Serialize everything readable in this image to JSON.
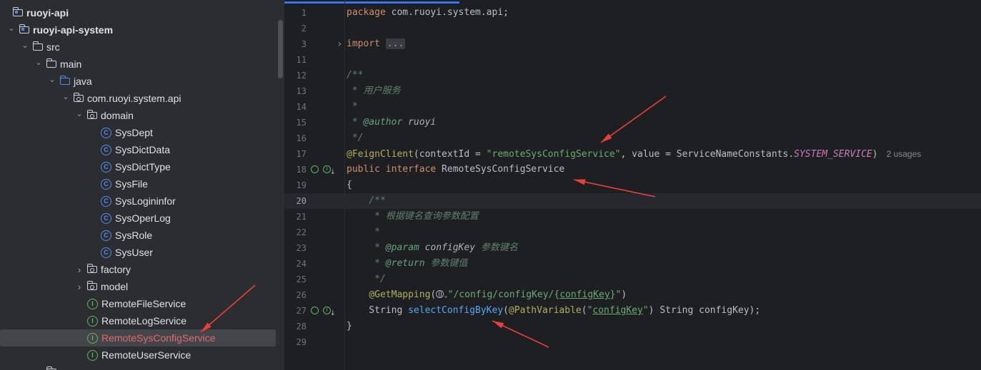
{
  "project_tree": {
    "items": [
      {
        "label": "ruoyi-api",
        "depth": 0,
        "icon": "module-folder-icon",
        "expand": "none",
        "bold": true
      },
      {
        "label": "ruoyi-api-system",
        "depth": 1,
        "icon": "module-folder-icon",
        "expand": "expanded",
        "bold": true
      },
      {
        "label": "src",
        "depth": 2,
        "icon": "folder-icon",
        "expand": "expanded"
      },
      {
        "label": "main",
        "depth": 3,
        "icon": "folder-icon",
        "expand": "expanded"
      },
      {
        "label": "java",
        "depth": 4,
        "icon": "source-folder-icon",
        "expand": "expanded"
      },
      {
        "label": "com.ruoyi.system.api",
        "depth": 5,
        "icon": "package-icon",
        "expand": "expanded"
      },
      {
        "label": "domain",
        "depth": 6,
        "icon": "package-icon",
        "expand": "expanded"
      },
      {
        "label": "SysDept",
        "depth": 7,
        "icon": "class-icon",
        "expand": "none"
      },
      {
        "label": "SysDictData",
        "depth": 7,
        "icon": "class-icon",
        "expand": "none"
      },
      {
        "label": "SysDictType",
        "depth": 7,
        "icon": "class-icon",
        "expand": "none"
      },
      {
        "label": "SysFile",
        "depth": 7,
        "icon": "class-icon",
        "expand": "none"
      },
      {
        "label": "SysLogininfor",
        "depth": 7,
        "icon": "class-icon",
        "expand": "none"
      },
      {
        "label": "SysOperLog",
        "depth": 7,
        "icon": "class-icon",
        "expand": "none"
      },
      {
        "label": "SysRole",
        "depth": 7,
        "icon": "class-icon",
        "expand": "none"
      },
      {
        "label": "SysUser",
        "depth": 7,
        "icon": "class-icon",
        "expand": "none"
      },
      {
        "label": "factory",
        "depth": 6,
        "icon": "package-icon",
        "expand": "collapsed"
      },
      {
        "label": "model",
        "depth": 6,
        "icon": "package-icon",
        "expand": "collapsed"
      },
      {
        "label": "RemoteFileService",
        "depth": 6,
        "icon": "interface-icon",
        "expand": "none"
      },
      {
        "label": "RemoteLogService",
        "depth": 6,
        "icon": "interface-icon",
        "expand": "none"
      },
      {
        "label": "RemoteSysConfigService",
        "depth": 6,
        "icon": "interface-icon",
        "expand": "none",
        "selected": true
      },
      {
        "label": "RemoteUserService",
        "depth": 6,
        "icon": "interface-icon",
        "expand": "none"
      },
      {
        "label": "",
        "depth": 3,
        "icon": "folder-icon",
        "expand": "collapsed"
      }
    ]
  },
  "editor": {
    "current_line": "20",
    "lines": [
      {
        "n": "1",
        "tokens": [
          [
            "kw",
            "package"
          ],
          [
            "t",
            " com.ruoyi.system.api;"
          ]
        ]
      },
      {
        "n": "2",
        "tokens": []
      },
      {
        "n": "3",
        "fold": true,
        "tokens": [
          [
            "kw",
            "import"
          ],
          [
            "t",
            " "
          ],
          [
            "dots",
            "..."
          ]
        ]
      },
      {
        "n": "11",
        "tokens": []
      },
      {
        "n": "12",
        "tokens": [
          [
            "doc",
            "/**"
          ]
        ]
      },
      {
        "n": "13",
        "tokens": [
          [
            "doc",
            " * 用户服务"
          ]
        ]
      },
      {
        "n": "14",
        "tokens": [
          [
            "doc",
            " *"
          ]
        ]
      },
      {
        "n": "15",
        "tokens": [
          [
            "doc",
            " * "
          ],
          [
            "tag",
            "@author"
          ],
          [
            "tagv",
            " ruoyi"
          ]
        ]
      },
      {
        "n": "16",
        "tokens": [
          [
            "doc",
            " */"
          ]
        ]
      },
      {
        "n": "17",
        "tokens": [
          [
            "ann",
            "@FeignClient"
          ],
          [
            "t",
            "(contextId = "
          ],
          [
            "str",
            "\"remoteSysConfigService\""
          ],
          [
            "t",
            ", value = ServiceNameConstants."
          ],
          [
            "static",
            "SYSTEM_SERVICE"
          ],
          [
            "t",
            ")"
          ],
          [
            "hint",
            "2 usages"
          ]
        ]
      },
      {
        "n": "18",
        "gutter": "impl",
        "tokens": [
          [
            "kw",
            "public interface"
          ],
          [
            "t",
            " RemoteSysConfigService"
          ]
        ]
      },
      {
        "n": "19",
        "tokens": [
          [
            "t",
            "{"
          ]
        ]
      },
      {
        "n": "20",
        "tokens": [
          [
            "doc",
            "    /**"
          ]
        ]
      },
      {
        "n": "21",
        "tokens": [
          [
            "doc",
            "     * 根据键名查询参数配置"
          ]
        ]
      },
      {
        "n": "22",
        "tokens": [
          [
            "doc",
            "     *"
          ]
        ]
      },
      {
        "n": "23",
        "tokens": [
          [
            "doc",
            "     * "
          ],
          [
            "tag",
            "@param"
          ],
          [
            "tagv",
            " configKey"
          ],
          [
            "doc",
            " 参数键名"
          ]
        ]
      },
      {
        "n": "24",
        "tokens": [
          [
            "doc",
            "     * "
          ],
          [
            "tag",
            "@return"
          ],
          [
            "doc",
            " 参数键值"
          ]
        ]
      },
      {
        "n": "25",
        "tokens": [
          [
            "doc",
            "     */"
          ]
        ]
      },
      {
        "n": "26",
        "tokens": [
          [
            "t",
            "    "
          ],
          [
            "ann",
            "@GetMapping"
          ],
          [
            "t",
            "("
          ],
          [
            "globe",
            ""
          ],
          [
            "str",
            "\"/config/configKey/{"
          ],
          [
            "strul",
            "configKey"
          ],
          [
            "str",
            "}\""
          ],
          [
            "t",
            ")"
          ]
        ]
      },
      {
        "n": "27",
        "gutter": "impl2",
        "tokens": [
          [
            "t",
            "    String "
          ],
          [
            "fn",
            "selectConfigByKey"
          ],
          [
            "t",
            "("
          ],
          [
            "ann",
            "@PathVariable"
          ],
          [
            "t",
            "("
          ],
          [
            "str",
            "\""
          ],
          [
            "strul",
            "configKey"
          ],
          [
            "str",
            "\""
          ],
          [
            "t",
            ") String configKey);"
          ]
        ]
      },
      {
        "n": "28",
        "tokens": [
          [
            "t",
            "}"
          ]
        ]
      },
      {
        "n": "29",
        "tokens": []
      }
    ]
  },
  "colors": {
    "annotation_arrow": "#e8403a",
    "selection_text": "#e06c6c",
    "accent": "#3574f0"
  }
}
